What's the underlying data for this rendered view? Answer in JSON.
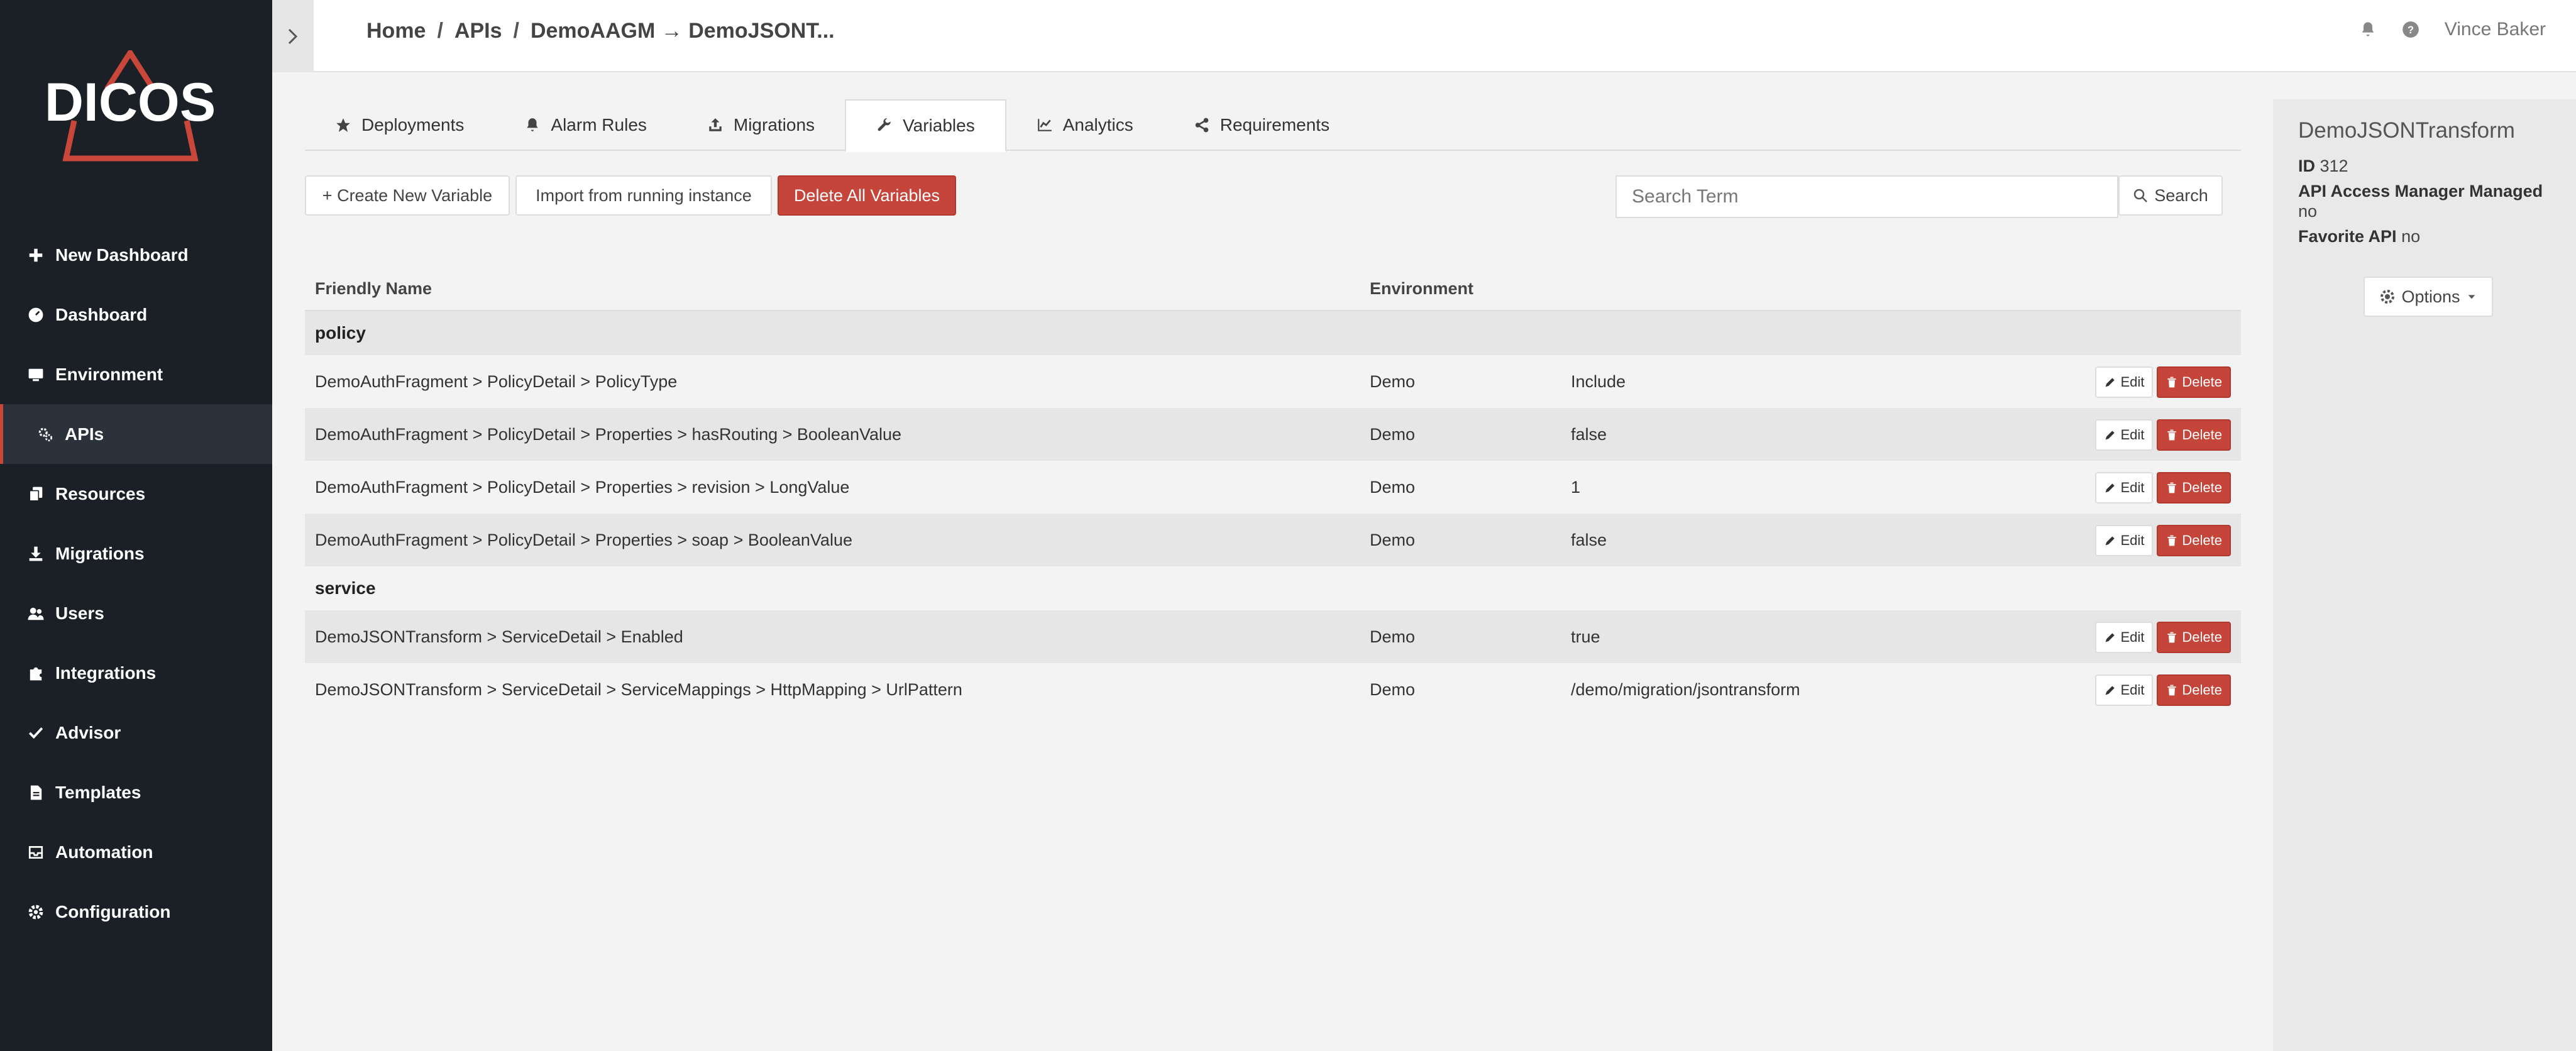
{
  "app": {
    "name": "DICOS"
  },
  "breadcrumb": {
    "home": "Home",
    "apis": "APIs",
    "current": "DemoAAGM → DemoJSONT..."
  },
  "user": {
    "name": "Vince Baker"
  },
  "sidebar": {
    "items": [
      {
        "label": "New Dashboard",
        "icon": "plus-icon"
      },
      {
        "label": "Dashboard",
        "icon": "dashboard-icon"
      },
      {
        "label": "Environment",
        "icon": "monitor-icon"
      },
      {
        "label": "APIs",
        "icon": "cogs-icon",
        "active": true
      },
      {
        "label": "Resources",
        "icon": "copy-icon"
      },
      {
        "label": "Migrations",
        "icon": "download-icon"
      },
      {
        "label": "Users",
        "icon": "users-icon"
      },
      {
        "label": "Integrations",
        "icon": "puzzle-icon"
      },
      {
        "label": "Advisor",
        "icon": "check-icon"
      },
      {
        "label": "Templates",
        "icon": "file-icon"
      },
      {
        "label": "Automation",
        "icon": "inbox-icon"
      },
      {
        "label": "Configuration",
        "icon": "gear-icon"
      }
    ]
  },
  "tabs": [
    {
      "label": "Deployments",
      "icon": "star-icon"
    },
    {
      "label": "Alarm Rules",
      "icon": "bell-icon"
    },
    {
      "label": "Migrations",
      "icon": "upload-icon"
    },
    {
      "label": "Variables",
      "icon": "wrench-icon",
      "active": true
    },
    {
      "label": "Analytics",
      "icon": "chart-icon"
    },
    {
      "label": "Requirements",
      "icon": "share-icon"
    }
  ],
  "actions": {
    "create": "+ Create New Variable",
    "import": "Import from running instance",
    "delete_all": "Delete All Variables",
    "search_placeholder": "Search Term",
    "search": "Search"
  },
  "table": {
    "headers": {
      "name": "Friendly Name",
      "env": "Environment"
    },
    "edit_label": "Edit",
    "delete_label": "Delete",
    "groups": [
      {
        "name": "policy",
        "rows": [
          {
            "name": "DemoAuthFragment > PolicyDetail > PolicyType",
            "env": "Demo",
            "value": "Include"
          },
          {
            "name": "DemoAuthFragment > PolicyDetail > Properties > hasRouting > BooleanValue",
            "env": "Demo",
            "value": "false"
          },
          {
            "name": "DemoAuthFragment > PolicyDetail > Properties > revision > LongValue",
            "env": "Demo",
            "value": "1"
          },
          {
            "name": "DemoAuthFragment > PolicyDetail > Properties > soap > BooleanValue",
            "env": "Demo",
            "value": "false"
          }
        ]
      },
      {
        "name": "service",
        "rows": [
          {
            "name": "DemoJSONTransform > ServiceDetail > Enabled",
            "env": "Demo",
            "value": "true"
          },
          {
            "name": "DemoJSONTransform > ServiceDetail > ServiceMappings > HttpMapping > UrlPattern",
            "env": "Demo",
            "value": "/demo/migration/jsontransform"
          }
        ]
      }
    ]
  },
  "panel": {
    "title": "DemoJSONTransform",
    "id_label": "ID",
    "id_value": "312",
    "managed_label": "API Access Manager Managed",
    "managed_value": "no",
    "favorite_label": "Favorite API",
    "favorite_value": "no",
    "options": "Options"
  }
}
